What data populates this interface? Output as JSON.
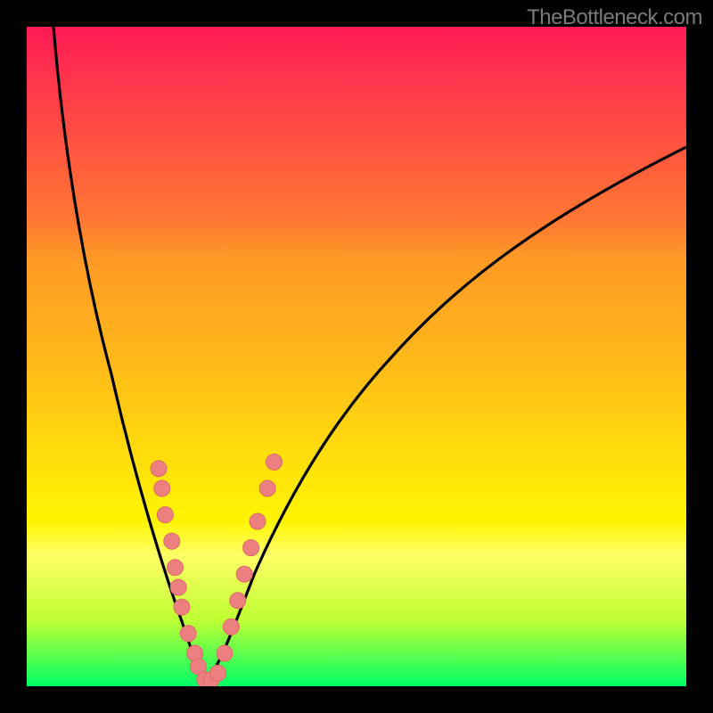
{
  "watermark": "TheBottleneck.com",
  "colors": {
    "curve_stroke": "#000000",
    "marker_fill": "#ec8080",
    "marker_stroke": "#e06868",
    "background_black": "#000000"
  },
  "chart_data": {
    "type": "line",
    "title": "",
    "xlabel": "",
    "ylabel": "",
    "xlim": [
      0,
      100
    ],
    "ylim": [
      0,
      100
    ],
    "series": [
      {
        "name": "left-descending-curve",
        "x": [
          4,
          8,
          12,
          16,
          20,
          24,
          27
        ],
        "y": [
          100,
          65,
          40,
          24,
          12,
          4,
          0
        ]
      },
      {
        "name": "right-ascending-curve",
        "x": [
          27,
          32,
          40,
          50,
          60,
          75,
          90,
          100
        ],
        "y": [
          0,
          8,
          25,
          42,
          55,
          68,
          77,
          82
        ]
      }
    ],
    "markers_left": [
      {
        "x": 20,
        "y": 33
      },
      {
        "x": 20.5,
        "y": 30
      },
      {
        "x": 21,
        "y": 26
      },
      {
        "x": 22,
        "y": 22
      },
      {
        "x": 22.5,
        "y": 18
      },
      {
        "x": 23,
        "y": 15
      },
      {
        "x": 23.5,
        "y": 12
      },
      {
        "x": 24.5,
        "y": 8
      },
      {
        "x": 25.5,
        "y": 5
      },
      {
        "x": 26,
        "y": 3
      },
      {
        "x": 27,
        "y": 1
      },
      {
        "x": 28,
        "y": 1
      }
    ],
    "markers_right": [
      {
        "x": 29,
        "y": 2
      },
      {
        "x": 30,
        "y": 5
      },
      {
        "x": 31,
        "y": 9
      },
      {
        "x": 32,
        "y": 13
      },
      {
        "x": 33,
        "y": 17
      },
      {
        "x": 34,
        "y": 21
      },
      {
        "x": 35,
        "y": 25
      },
      {
        "x": 36.5,
        "y": 30
      },
      {
        "x": 37.5,
        "y": 34
      }
    ]
  }
}
